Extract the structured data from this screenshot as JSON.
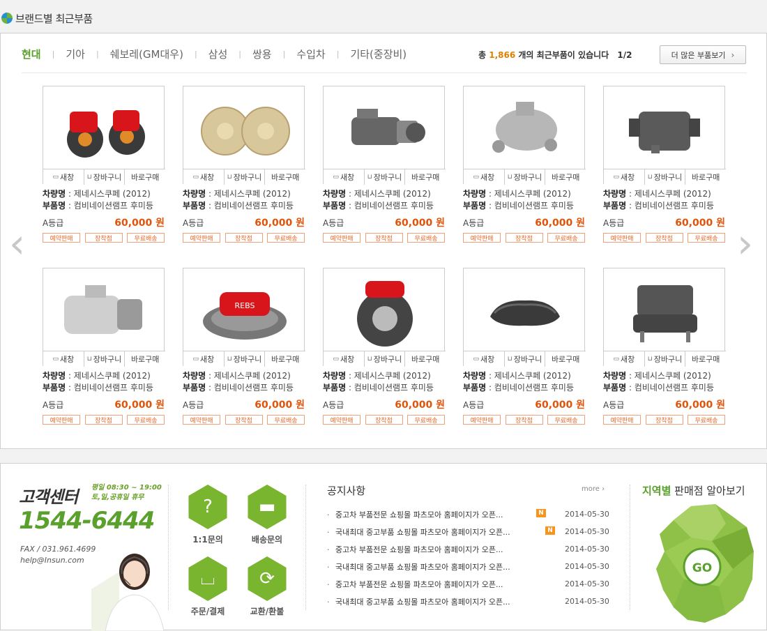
{
  "header": {
    "title": "브랜드별 최근부품"
  },
  "tabs": [
    {
      "label": "현대",
      "active": true
    },
    {
      "label": "기아"
    },
    {
      "label": "쉐보레(GM대우)"
    },
    {
      "label": "삼성"
    },
    {
      "label": "쌍용"
    },
    {
      "label": "수입차"
    },
    {
      "label": "기타(중장비)"
    }
  ],
  "summary": {
    "prefix": "총",
    "count": "1,866",
    "suffix": "개의 최근부품이 있습니다",
    "page": "1/2"
  },
  "more_button": {
    "label": "더 많은 부품보기",
    "chevron": "›"
  },
  "nav": {
    "prev": "‹",
    "next": "›"
  },
  "card_labels": {
    "new_window": "새창",
    "cart": "장바구니",
    "buy_now": "바로구매",
    "vehicle_label": "차량명",
    "part_label": "부품명"
  },
  "products": [
    {
      "image": "red-brake-caliper-set-icon",
      "vehicle": "제네시스쿠페 (2012)",
      "part": "컴비네이션램프 후미등",
      "grade": "A등급",
      "price": "60,000 원",
      "badges": [
        "예약판매",
        "장착점",
        "무료배송"
      ]
    },
    {
      "image": "gold-brake-discs-icon",
      "vehicle": "제네시스쿠페 (2012)",
      "part": "컴비네이션램프 후미등",
      "grade": "A등급",
      "price": "60,000 원",
      "badges": [
        "예약판매",
        "장착점",
        "무료배송"
      ]
    },
    {
      "image": "starter-motor-icon",
      "vehicle": "제네시스쿠페 (2012)",
      "part": "컴비네이션램프 후미등",
      "grade": "A등급",
      "price": "60,000 원",
      "badges": [
        "예약판매",
        "장착점",
        "무료배송"
      ]
    },
    {
      "image": "water-pump-icon",
      "vehicle": "제네시스쿠페 (2012)",
      "part": "컴비네이션램프 후미등",
      "grade": "A등급",
      "price": "60,000 원",
      "badges": [
        "예약판매",
        "장착점",
        "무료배송"
      ]
    },
    {
      "image": "grey-brake-caliper-icon",
      "vehicle": "제네시스쿠페 (2012)",
      "part": "컴비네이션램프 후미등",
      "grade": "A등급",
      "price": "60,000 원",
      "badges": [
        "예약판매",
        "장착점",
        "무료배송"
      ]
    },
    {
      "image": "alternator-icon",
      "vehicle": "제네시스쿠페 (2012)",
      "part": "컴비네이션램프 후미등",
      "grade": "A등급",
      "price": "60,000 원",
      "badges": [
        "예약판매",
        "장착점",
        "무료배송"
      ]
    },
    {
      "image": "rebs-brake-kit-icon",
      "vehicle": "제네시스쿠페 (2012)",
      "part": "컴비네이션램프 후미등",
      "grade": "A등급",
      "price": "60,000 원",
      "badges": [
        "예약판매",
        "장착점",
        "무료배송"
      ]
    },
    {
      "image": "brembo-brake-disc-icon",
      "vehicle": "제네시스쿠페 (2012)",
      "part": "컴비네이션램프 후미등",
      "grade": "A등급",
      "price": "60,000 원",
      "badges": [
        "예약판매",
        "장착점",
        "무료배송"
      ]
    },
    {
      "image": "brake-pads-icon",
      "vehicle": "제네시스쿠페 (2012)",
      "part": "컴비네이션램프 후미등",
      "grade": "A등급",
      "price": "60,000 원",
      "badges": [
        "예약판매",
        "장착점",
        "무료배송"
      ]
    },
    {
      "image": "car-seat-icon",
      "vehicle": "제네시스쿠페 (2012)",
      "part": "컴비네이션램프 후미등",
      "grade": "A등급",
      "price": "60,000 원",
      "badges": [
        "예약판매",
        "장착점",
        "무료배송"
      ]
    }
  ],
  "customer_center": {
    "title": "고객센터",
    "hours_line1": "평일 08:30 ~ 19:00",
    "hours_line2": "토,일,공휴일 휴무",
    "phone": "1544-6444",
    "fax": "FAX / 031.961.4699",
    "email": "help@Insun.com"
  },
  "services": [
    {
      "label": "1:1문의",
      "icon": "person-question-icon"
    },
    {
      "label": "배송문의",
      "icon": "truck-icon"
    },
    {
      "label": "주문/결제",
      "icon": "shopping-basket-icon"
    },
    {
      "label": "교환/환불",
      "icon": "exchange-arrows-icon"
    }
  ],
  "notices": {
    "title": "공지사항",
    "more": "more ›",
    "items": [
      {
        "text": "중고차 부품전문 쇼핑몰 파츠모아 홈페이지가 오픈...",
        "date": "2014-05-30",
        "new": true
      },
      {
        "text": "국내최대 중고부품 쇼핑몰 파츠모아 홈페이지가 오픈...",
        "date": "2014-05-30",
        "new": true
      },
      {
        "text": "중고차 부품전문 쇼핑몰 파츠모아 홈페이지가 오픈...",
        "date": "2014-05-30",
        "new": false
      },
      {
        "text": "국내최대 중고부품 쇼핑몰 파츠모아 홈페이지가 오픈...",
        "date": "2014-05-30",
        "new": false
      },
      {
        "text": "중고차 부품전문 쇼핑몰 파츠모아 홈페이지가 오픈...",
        "date": "2014-05-30",
        "new": false
      },
      {
        "text": "국내최대 중고부품 쇼핑몰 파츠모아 홈페이지가 오픈...",
        "date": "2014-05-30",
        "new": false
      }
    ],
    "new_badge": "N",
    "bullet": "·"
  },
  "region": {
    "title_highlight": "지역별",
    "title_rest": " 판매점 알아보기",
    "go": "GO"
  },
  "colors": {
    "accent": "#5aa02c",
    "price": "#e0540a",
    "count": "#e07f00",
    "badge_border": "#f1a07a",
    "new_badge": "#f7941d"
  }
}
